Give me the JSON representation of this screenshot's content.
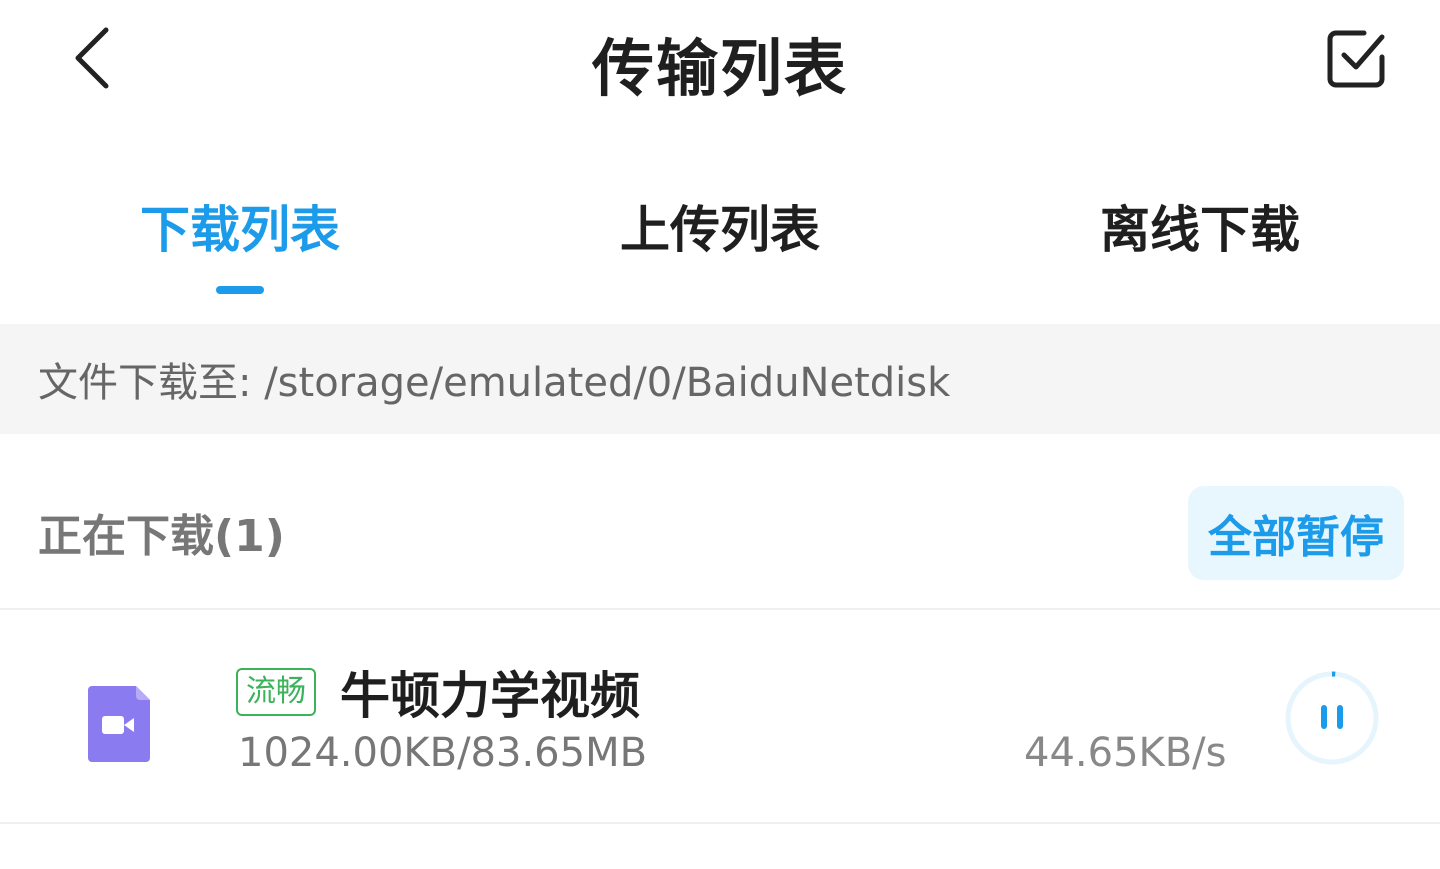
{
  "header": {
    "title": "传输列表",
    "back_icon": "chevron-left-icon",
    "select_icon": "checkbox-select-icon"
  },
  "tabs": [
    {
      "label": "下载列表",
      "active": true
    },
    {
      "label": "上传列表",
      "active": false
    },
    {
      "label": "离线下载",
      "active": false
    }
  ],
  "path_bar": {
    "text": "文件下载至: /storage/emulated/0/BaiduNetdisk"
  },
  "downloading": {
    "title": "正在下载(1)",
    "pause_all_label": "全部暂停"
  },
  "items": [
    {
      "icon": "video-file-icon",
      "badge": "流畅",
      "name": "牛顿力学视频",
      "progress": "1024.00KB/83.65MB",
      "speed": "44.65KB/s",
      "percent_complete": 1.2
    }
  ],
  "colors": {
    "accent": "#1b9bea",
    "badge_green": "#3cb35a",
    "video_icon": "#8b7bf0"
  }
}
